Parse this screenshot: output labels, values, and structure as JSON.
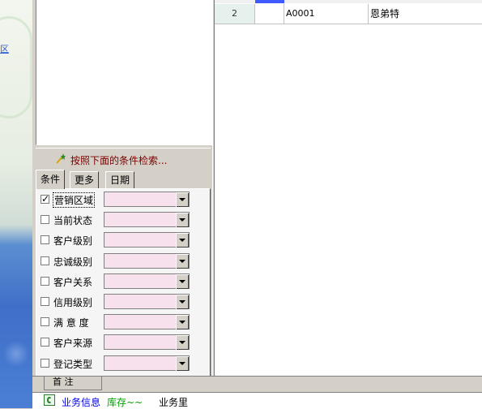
{
  "desktop": {
    "link_fragment": "区"
  },
  "search": {
    "label": "按照下面的条件检索..."
  },
  "tabs": [
    {
      "label": "条件"
    },
    {
      "label": "更多"
    },
    {
      "label": "日期"
    }
  ],
  "filters": [
    {
      "label": "营销区域",
      "checked": true
    },
    {
      "label": "当前状态",
      "checked": false
    },
    {
      "label": "客户级别",
      "checked": false
    },
    {
      "label": "忠诚级别",
      "checked": false
    },
    {
      "label": "客户关系",
      "checked": false
    },
    {
      "label": "信用级别",
      "checked": false
    },
    {
      "label": "满 意 度",
      "checked": false
    },
    {
      "label": "客户来源",
      "checked": false
    },
    {
      "label": "登记类型",
      "checked": false
    }
  ],
  "grid": {
    "rows": [
      {
        "num": "2",
        "col2": "",
        "code": "A0001",
        "name": "恩弟特"
      }
    ]
  },
  "bottom": {
    "tab_stub": "首  注"
  },
  "status": {
    "item1": "业务信息",
    "item2": "库存~~",
    "item3": "业务里"
  },
  "colors": {
    "combo_bg": "#f6e1ec",
    "row_num_bg": "#e6f1ee",
    "search_text": "#7a0000",
    "selected_header": "#3e5bff"
  }
}
